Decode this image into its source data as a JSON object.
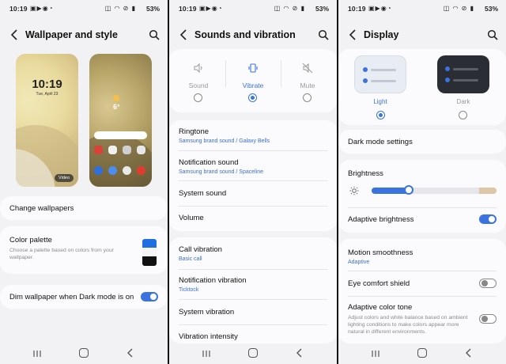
{
  "status": {
    "time": "10:19",
    "battery": "53%"
  },
  "panel1": {
    "title": "Wallpaper and style",
    "lock_time": "10:19",
    "lock_date": "Tue, April 23",
    "video_chip": "Video",
    "home_temp": "6°",
    "change_wallpapers": "Change wallpapers",
    "color_palette": {
      "title": "Color palette",
      "desc": "Choose a palette based on colors from your wallpaper.",
      "swatches": [
        "#1f6fe0",
        "#f5f5f5",
        "#111111"
      ]
    },
    "dim": {
      "label": "Dim wallpaper when Dark mode is on",
      "on": true
    }
  },
  "panel2": {
    "title": "Sounds and vibration",
    "modes": [
      {
        "label": "Sound",
        "icon": "speaker-icon",
        "selected": false
      },
      {
        "label": "Vibrate",
        "icon": "vibrate-icon",
        "selected": true
      },
      {
        "label": "Mute",
        "icon": "mute-icon",
        "selected": false
      }
    ],
    "items": [
      {
        "title": "Ringtone",
        "sub": "Samsung brand sound / Galaxy Bells"
      },
      {
        "title": "Notification sound",
        "sub": "Samsung brand sound / Spaceline"
      },
      {
        "title": "System sound",
        "sub": ""
      },
      {
        "title": "Volume",
        "sub": ""
      },
      {
        "title": "Call vibration",
        "sub": "Basic call"
      },
      {
        "title": "Notification vibration",
        "sub": "Ticktock"
      },
      {
        "title": "System vibration",
        "sub": ""
      },
      {
        "title": "Vibration intensity",
        "sub": ""
      }
    ]
  },
  "panel3": {
    "title": "Display",
    "themes": [
      {
        "label": "Light",
        "selected": true
      },
      {
        "label": "Dark",
        "selected": false
      }
    ],
    "dark_mode_settings": "Dark mode settings",
    "brightness": {
      "label": "Brightness",
      "level": 0.3
    },
    "adaptive_brightness": {
      "label": "Adaptive brightness",
      "on": true
    },
    "motion": {
      "title": "Motion smoothness",
      "sub": "Adaptive"
    },
    "eye_comfort": {
      "label": "Eye comfort shield",
      "on": false
    },
    "adaptive_color": {
      "title": "Adaptive color tone",
      "desc": "Adjust colors and white balance based on ambient lighting conditions to make colors appear more natural in different environments.",
      "on": false
    }
  },
  "colors": {
    "accent": "#3a73e0",
    "sub_text": "#3a6fcf",
    "background": "#f2f2f4",
    "card": "#fbfbfd"
  }
}
